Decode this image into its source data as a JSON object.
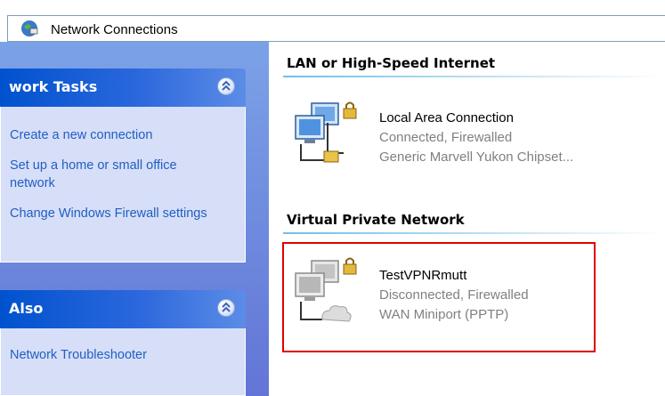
{
  "address_bar": {
    "icon": "network-connections-icon",
    "text": "Network Connections"
  },
  "taskpane": {
    "network_tasks": {
      "title": "work Tasks",
      "links": [
        {
          "label": "Create a new connection"
        },
        {
          "label": "Set up a home or small office network"
        },
        {
          "label": "Change Windows Firewall settings"
        }
      ]
    },
    "see_also": {
      "title": "Also",
      "links": [
        {
          "label": "Network Troubleshooter"
        }
      ]
    }
  },
  "content": {
    "groups": [
      {
        "header": "LAN or High-Speed Internet",
        "connections": [
          {
            "name": "Local Area Connection",
            "status": "Connected, Firewalled",
            "device": "Generic Marvell Yukon Chipset..."
          }
        ]
      },
      {
        "header": "Virtual Private Network",
        "connections": [
          {
            "name": "TestVPNRmutt",
            "status": "Disconnected, Firewalled",
            "device": "WAN Miniport (PPTP)"
          }
        ]
      }
    ]
  },
  "colors": {
    "highlight": "#e00000",
    "link": "#215dc6",
    "taskpane_bg": "#7ba2e7"
  }
}
